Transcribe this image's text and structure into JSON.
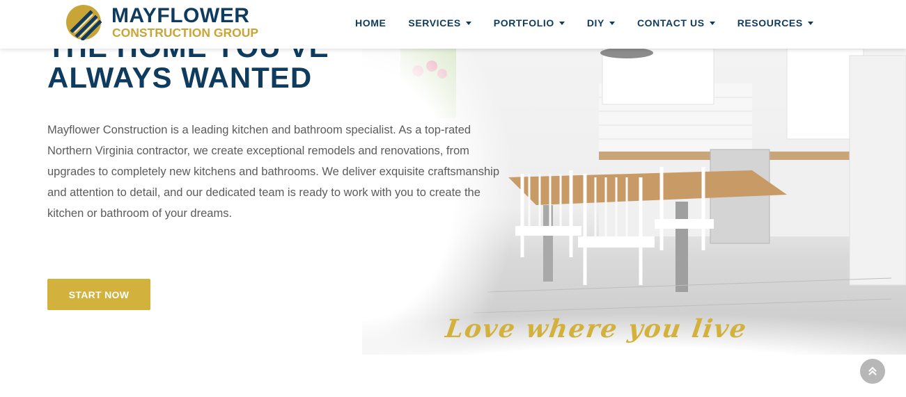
{
  "brand": {
    "name": "MAYFLOWER",
    "subtitle": "CONSTRUCTION GROUP",
    "colors": {
      "navy": "#0e3b5e",
      "gold": "#c9a437",
      "button_gold": "#d2b13c"
    }
  },
  "nav": {
    "items": [
      {
        "label": "HOME",
        "has_dropdown": false
      },
      {
        "label": "SERVICES",
        "has_dropdown": true
      },
      {
        "label": "PORTFOLIO",
        "has_dropdown": true
      },
      {
        "label": "DIY",
        "has_dropdown": true
      },
      {
        "label": "CONTACT US",
        "has_dropdown": true
      },
      {
        "label": "RESOURCES",
        "has_dropdown": true
      }
    ]
  },
  "hero": {
    "headline_partial": "THE HOME YOU'VE",
    "headline": "ALWAYS WANTED",
    "description": "Mayflower Construction is a leading kitchen and bathroom specialist. As a top-rated Northern Virginia contractor, we create exceptional remodels and renovations, from upgrades to completely new kitchens and bathrooms. We deliver exquisite craftsmanship and attention to detail, and our dedicated team is ready to work with you to create the kitchen or bathroom of your dreams.",
    "cta_label": "START NOW",
    "tagline": "Love where you live",
    "image_icon": "kitchen-photo"
  },
  "scroll_top": {
    "icon": "double-chevron-up-icon"
  }
}
